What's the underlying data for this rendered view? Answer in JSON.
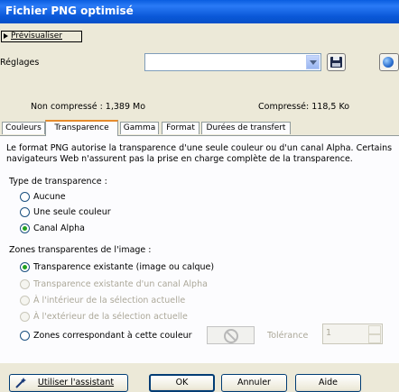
{
  "window": {
    "title": "Fichier PNG optimisé"
  },
  "preview_button": "Prévisualiser",
  "settings": {
    "label": "Réglages",
    "value": ""
  },
  "sizes": {
    "uncompressed": "Non compressé : 1,389 Mo",
    "compressed": "Compressé: 118,5 Ko"
  },
  "tabs": [
    "Couleurs",
    "Transparence",
    "Gamma",
    "Format",
    "Durées de transfert"
  ],
  "active_tab": "Transparence",
  "description": {
    "line1": "Le format PNG autorise la transparence d'une seule couleur ou d'un canal Alpha. Certains",
    "line2": "navigateurs Web n'assurent pas la prise en charge complète de la transparence."
  },
  "transparency_type": {
    "label": "Type de transparence :",
    "options": [
      "Aucune",
      "Une seule couleur",
      "Canal Alpha"
    ],
    "selected": "Canal Alpha"
  },
  "zones": {
    "label": "Zones transparentes de l'image :",
    "options": [
      "Transparence existante (image ou calque)",
      "Transparence existante d'un canal Alpha",
      "À l'intérieur de la sélection actuelle",
      "À l'extérieur de la sélection actuelle",
      "Zones correspondant à cette couleur"
    ],
    "selected": "Transparence existante (image ou calque)"
  },
  "tolerance": {
    "label": "Tolérance",
    "value": "1"
  },
  "buttons": {
    "assistant": "Utiliser l'assistant",
    "ok": "OK",
    "cancel": "Annuler",
    "help": "Aide"
  },
  "colors": {
    "titlebar": "#0a58d8",
    "dialog_bg": "#ece9d8",
    "active_tab_accent": "#e68b2c",
    "radio_selected": "#21a121"
  }
}
